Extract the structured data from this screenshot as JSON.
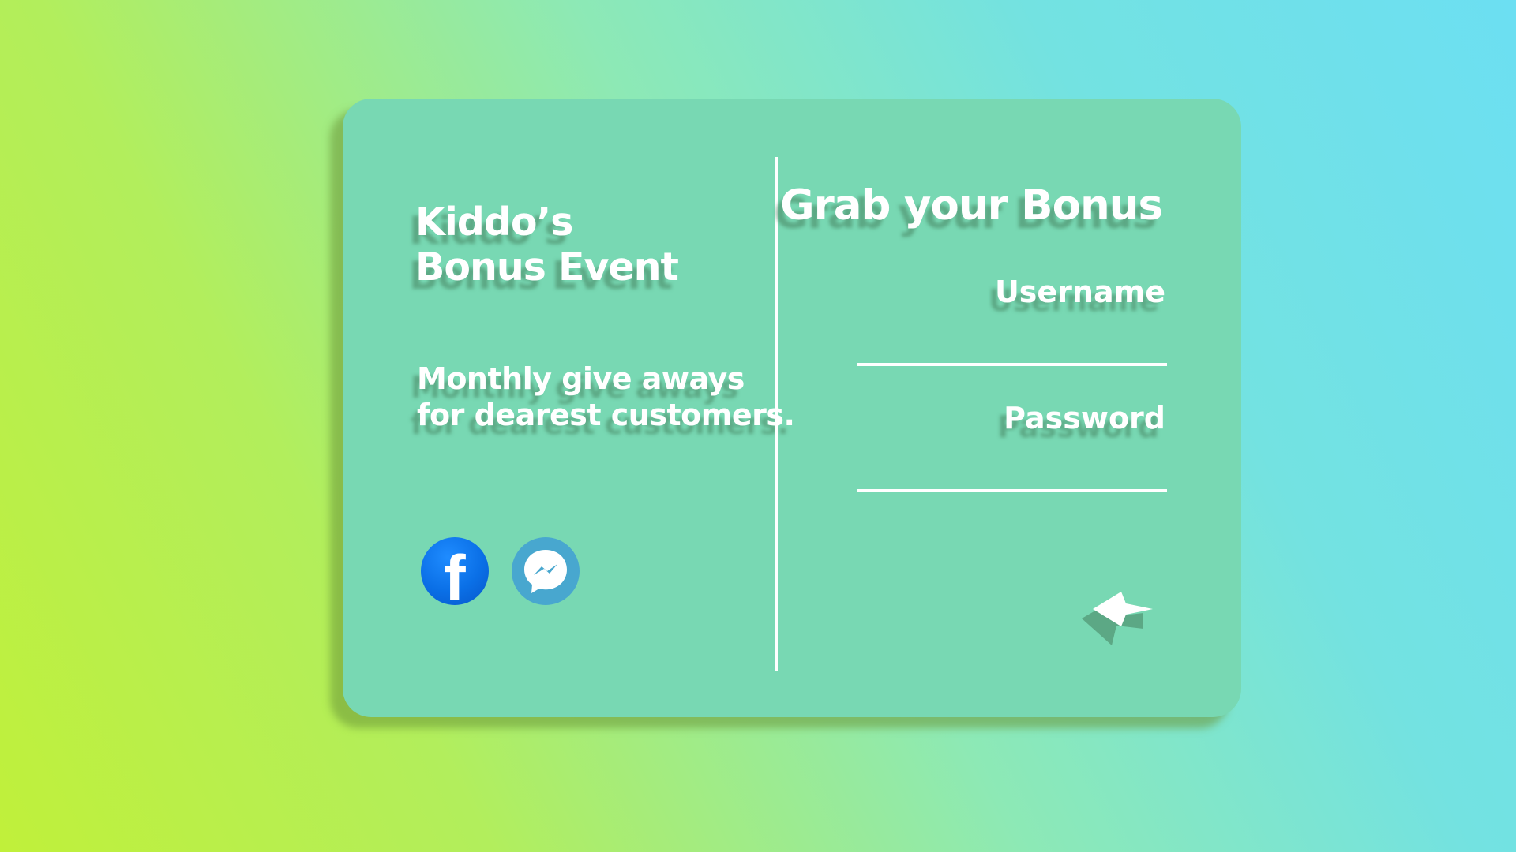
{
  "left_panel": {
    "title_line1": "Kiddo’s",
    "title_line2": "Bonus Event",
    "tagline_line1": "Monthly give aways",
    "tagline_line2": "for dearest customers."
  },
  "right_panel": {
    "heading": "Grab your Bonus",
    "username_label": "Username",
    "password_label": "Password"
  },
  "social": {
    "facebook_letter": "f"
  },
  "icons": {
    "facebook": "facebook-icon",
    "messenger": "messenger-icon",
    "submit": "arrow-right-icon"
  },
  "colors": {
    "card": "#78d8b3",
    "text": "#ffffff",
    "facebook_blue": "#0a6fe6",
    "messenger_blue": "#48a7cf"
  }
}
